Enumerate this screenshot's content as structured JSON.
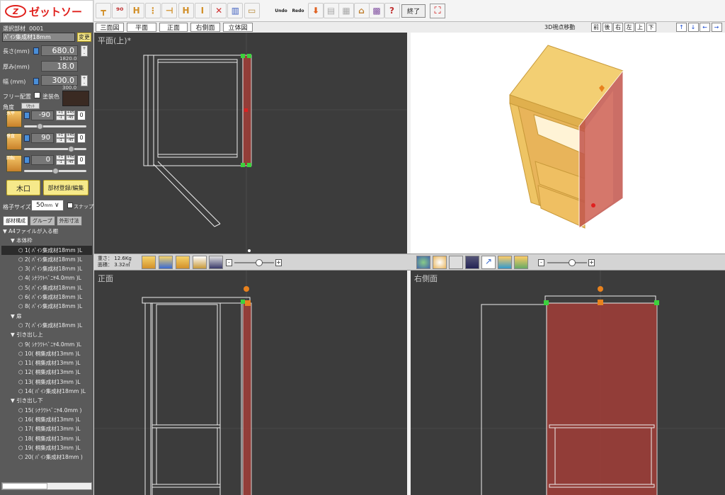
{
  "app": {
    "logo_text": "ゼットソー",
    "logo_mark": "Z"
  },
  "left": {
    "selected_label": "選択部材",
    "selected_id": "0001",
    "part_name": "ﾊﾟｲﾝ集成材18mm",
    "change_btn": "変更",
    "length_label": "長さ(mm)",
    "length_value": "680.0",
    "length_max": "1820.0",
    "thickness_label": "厚み(mm)",
    "thickness_value": "18.0",
    "width_label": "幅 (mm)",
    "width_value": "300.0",
    "width_max": "300.0",
    "free_place": "フリー配置",
    "paint_color": "塗装色",
    "paint_hex": "#3a2a22",
    "angle_label": "角度",
    "reset_btn": "ﾘｾｯﾄ",
    "angles": [
      {
        "label": "水平",
        "value": "-90",
        "zero": "0",
        "level": 0.25
      },
      {
        "label": "垂直",
        "value": "90",
        "zero": "0",
        "level": 0.75
      },
      {
        "label": "回転",
        "value": "0",
        "zero": "0",
        "level": 0.5
      }
    ],
    "step_plus": "+1",
    "step_minus": "-1",
    "step_plus45": "+45",
    "step_minus45": "-45",
    "kiguchi_btn": "木口",
    "register_btn": "部材登録/編集",
    "grid_label": "格子サイズ",
    "grid_value": "50",
    "grid_unit": "mm",
    "snap_label": "スナップ",
    "tabs": [
      "部材構成",
      "グループ",
      "外形寸法"
    ],
    "tree": [
      {
        "text": "▼ A4ファイルが入る棚",
        "indent": 0,
        "type": "folder"
      },
      {
        "text": "▼ 本体枠",
        "indent": 1,
        "type": "folder"
      },
      {
        "text": "1( ﾊﾟｲﾝ集成材18mm )L",
        "indent": 2,
        "type": "item",
        "sel": true
      },
      {
        "text": "2( ﾊﾟｲﾝ集成材18mm )L",
        "indent": 2,
        "type": "item"
      },
      {
        "text": "3( ﾊﾟｲﾝ集成材18mm )L",
        "indent": 2,
        "type": "item"
      },
      {
        "text": "4( ｼﾅﾗﾜﾄﾍﾞﾆﾔ4.0mm )L",
        "indent": 2,
        "type": "item"
      },
      {
        "text": "5( ﾊﾟｲﾝ集成材18mm )L",
        "indent": 2,
        "type": "item"
      },
      {
        "text": "6( ﾊﾟｲﾝ集成材18mm )L",
        "indent": 2,
        "type": "item"
      },
      {
        "text": "8( ﾊﾟｲﾝ集成材18mm )L",
        "indent": 2,
        "type": "item"
      },
      {
        "text": "▼ 扉",
        "indent": 1,
        "type": "folder"
      },
      {
        "text": "7( ﾊﾟｲﾝ集成材18mm )L",
        "indent": 2,
        "type": "item"
      },
      {
        "text": "▼ 引き出し上",
        "indent": 1,
        "type": "folder"
      },
      {
        "text": "9( ｼﾅﾗﾜﾄﾍﾞﾆﾔ4.0mm )L",
        "indent": 2,
        "type": "item"
      },
      {
        "text": "10( 桐集成材13mm )L",
        "indent": 2,
        "type": "item"
      },
      {
        "text": "11( 桐集成材13mm )L",
        "indent": 2,
        "type": "item"
      },
      {
        "text": "12( 桐集成材13mm )L",
        "indent": 2,
        "type": "item"
      },
      {
        "text": "13( 桐集成材13mm )L",
        "indent": 2,
        "type": "item"
      },
      {
        "text": "14( ﾊﾟｲﾝ集成材18mm )L",
        "indent": 2,
        "type": "item"
      },
      {
        "text": "▼ 引き出し下",
        "indent": 1,
        "type": "folder"
      },
      {
        "text": "15( ｼﾅﾗﾜﾄﾍﾞﾆﾔ4.0mm )",
        "indent": 2,
        "type": "item"
      },
      {
        "text": "16( 桐集成材13mm )L",
        "indent": 2,
        "type": "item"
      },
      {
        "text": "17( 桐集成材13mm )L",
        "indent": 2,
        "type": "item"
      },
      {
        "text": "18( 桐集成材13mm )L",
        "indent": 2,
        "type": "item"
      },
      {
        "text": "19( 桐集成材13mm )L",
        "indent": 2,
        "type": "item"
      },
      {
        "text": "20( ﾊﾟｲﾝ集成材18mm )",
        "indent": 2,
        "type": "item"
      }
    ]
  },
  "toolbar": {
    "end_btn": "終了",
    "undo": "Undo",
    "redo": "Redo"
  },
  "viewtabs": [
    "三面図",
    "平面",
    "正面",
    "右側面",
    "立体図"
  ],
  "nav": {
    "label": "3D視点移動",
    "buttons": [
      "前",
      "後",
      "右",
      "左",
      "上",
      "下"
    ],
    "arrows": [
      "↑",
      "↓",
      "←",
      "→"
    ]
  },
  "views": {
    "top": "平面(上)*",
    "front": "正面",
    "side": "右側面"
  },
  "stats": {
    "weight_label": "重さ：",
    "weight": "12.6Kg",
    "area_label": "面積：",
    "area": "3.32㎡"
  },
  "colors": {
    "red": "#b0453e",
    "green": "#3cd23c",
    "orange": "#e8821e",
    "wood": "#f0c868"
  }
}
